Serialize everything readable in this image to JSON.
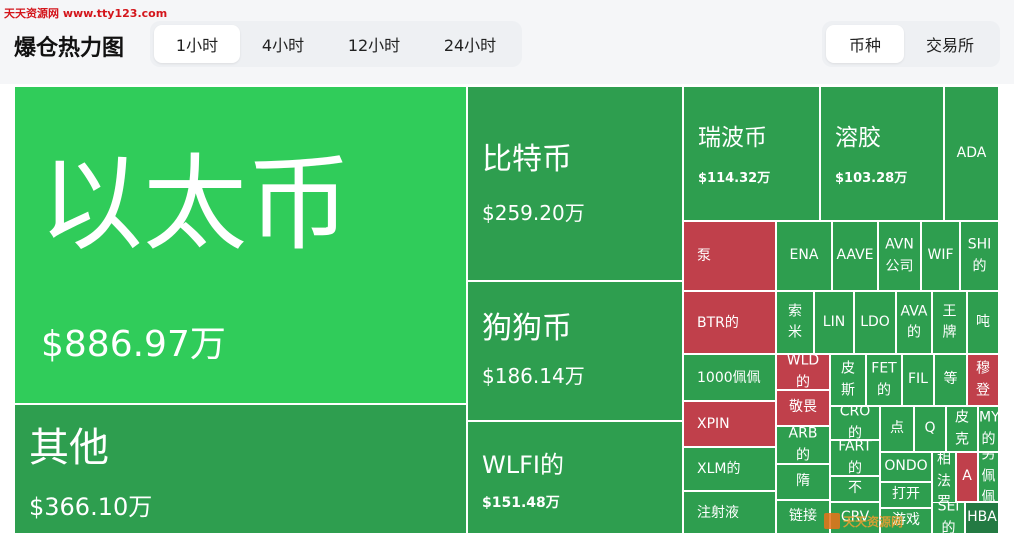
{
  "page": {
    "watermark_top": "天天资源网 www.tty123.com",
    "title": "爆仓热力图",
    "time_tabs": [
      "1小时",
      "4小时",
      "12小时",
      "24小时"
    ],
    "active_time_tab": "1小时",
    "view_tabs": [
      "币种",
      "交易所"
    ],
    "active_view_tab": "币种",
    "watermark_bottom": "天天资源网",
    "colors": {
      "bright_green": "#30cc5a",
      "green": "#2e9e4f",
      "dark_green": "#237a43",
      "red": "#c0404b",
      "header_bg": "#f5f6f8",
      "segment_bg": "#eef0f3"
    }
  },
  "tiles": [
    {
      "name": "以太币",
      "value": "$886.97万",
      "color": "bright_green"
    },
    {
      "name": "其他",
      "value": "$366.10万",
      "color": "green"
    },
    {
      "name": "比特币",
      "value": "$259.20万",
      "color": "green"
    },
    {
      "name": "狗狗币",
      "value": "$186.14万",
      "color": "green"
    },
    {
      "name": "WLFI的",
      "value": "$151.48万",
      "color": "green"
    },
    {
      "name": "瑞波币",
      "value": "$114.32万",
      "color": "green"
    },
    {
      "name": "溶胶",
      "value": "$103.28万",
      "color": "green"
    },
    {
      "name": "ADA",
      "color": "green"
    },
    {
      "name": "泵",
      "color": "red"
    },
    {
      "name": "ENA",
      "color": "green"
    },
    {
      "name": "AAVE",
      "color": "green"
    },
    {
      "name": "AVN\n公司",
      "color": "green"
    },
    {
      "name": "WIF",
      "color": "green"
    },
    {
      "name": "SHI\n的",
      "color": "green"
    },
    {
      "name": "BTR的",
      "color": "red"
    },
    {
      "name": "索\n米",
      "color": "green"
    },
    {
      "name": "LIN",
      "color": "green"
    },
    {
      "name": "LDO",
      "color": "green"
    },
    {
      "name": "AVA\n的",
      "color": "green"
    },
    {
      "name": "王\n牌",
      "color": "green"
    },
    {
      "name": "吨",
      "color": "green"
    },
    {
      "name": "1000佩佩",
      "color": "green"
    },
    {
      "name": "WLD\n的",
      "color": "red"
    },
    {
      "name": "皮\n斯",
      "color": "green"
    },
    {
      "name": "FET\n的",
      "color": "green"
    },
    {
      "name": "FIL",
      "color": "green"
    },
    {
      "name": "等",
      "color": "green"
    },
    {
      "name": "穆\n登",
      "color": "red"
    },
    {
      "name": "XPIN",
      "color": "red"
    },
    {
      "name": "敬畏",
      "color": "red"
    },
    {
      "name": "ARB\n的",
      "color": "green"
    },
    {
      "name": "CRO\n的",
      "color": "green"
    },
    {
      "name": "点",
      "color": "green"
    },
    {
      "name": "Q",
      "color": "green"
    },
    {
      "name": "皮\n克",
      "color": "green"
    },
    {
      "name": "MY\n的",
      "color": "green"
    },
    {
      "name": "XLM的",
      "color": "green"
    },
    {
      "name": "隋",
      "color": "green"
    },
    {
      "name": "FART\n的",
      "color": "green"
    },
    {
      "name": "ONDO",
      "color": "green"
    },
    {
      "name": "相\n法\n罗",
      "color": "green"
    },
    {
      "name": "A",
      "color": "red"
    },
    {
      "name": "另\n佩\n佩",
      "color": "green"
    },
    {
      "name": "不",
      "color": "green"
    },
    {
      "name": "打开",
      "color": "green"
    },
    {
      "name": "注射液",
      "color": "green"
    },
    {
      "name": "链接",
      "color": "green"
    },
    {
      "name": "CRV",
      "color": "green"
    },
    {
      "name": "游戏",
      "color": "green"
    },
    {
      "name": "SEI\n的",
      "color": "green"
    },
    {
      "name": "HBA",
      "color": "dark_green"
    }
  ]
}
